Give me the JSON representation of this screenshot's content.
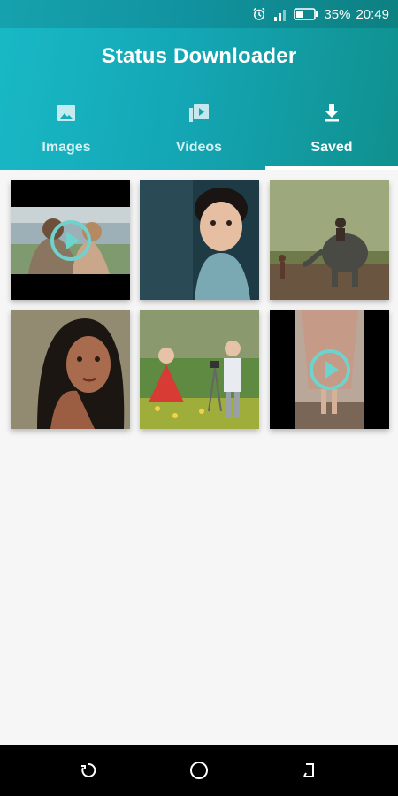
{
  "status_bar": {
    "battery": "35%",
    "time": "20:49",
    "icons": [
      "alarm-icon",
      "signal-icon",
      "battery-icon"
    ]
  },
  "app": {
    "title": "Status Downloader",
    "accent_gradient": [
      "#19b9c6",
      "#10908e"
    ]
  },
  "tabs": [
    {
      "label": "Images",
      "icon": "image-icon",
      "active": false
    },
    {
      "label": "Videos",
      "icon": "video-library-icon",
      "active": false
    },
    {
      "label": "Saved",
      "icon": "download-icon",
      "active": true
    }
  ],
  "saved_items": [
    {
      "type": "video",
      "thumbnail": "women-beach"
    },
    {
      "type": "image",
      "thumbnail": "child-portrait"
    },
    {
      "type": "image",
      "thumbnail": "elephant-rider"
    },
    {
      "type": "image",
      "thumbnail": "woman-portrait"
    },
    {
      "type": "image",
      "thumbnail": "kids-camera"
    },
    {
      "type": "video",
      "thumbnail": "dress-feet"
    }
  ],
  "navbar": {
    "icons": [
      "recent-apps-icon",
      "home-icon",
      "back-icon"
    ]
  }
}
